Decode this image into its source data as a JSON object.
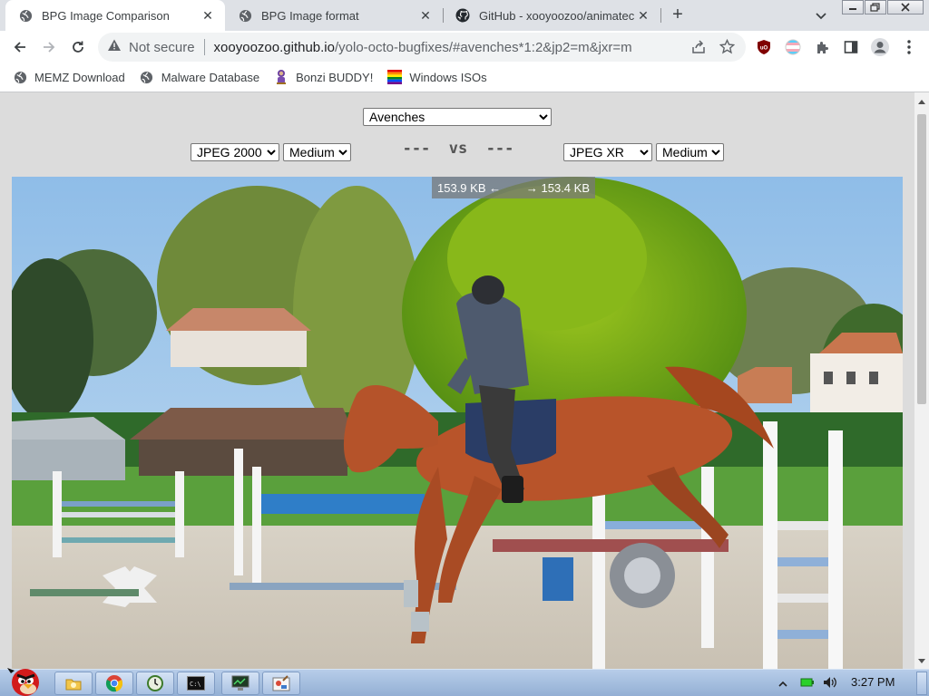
{
  "tabs": [
    {
      "title": "BPG Image Comparison",
      "active": true
    },
    {
      "title": "BPG Image format",
      "active": false
    },
    {
      "title": "GitHub - xooyoozoo/animatec",
      "active": false
    }
  ],
  "toolbar": {
    "security_label": "Not secure",
    "url_host": "xooyoozoo.github.io",
    "url_path": "/yolo-octo-bugfixes/#avenches*1:2&jp2=m&jxr=m"
  },
  "bookmarks": [
    {
      "label": "MEMZ Download",
      "icon": "globe-icon"
    },
    {
      "label": "Malware Database",
      "icon": "globe-icon"
    },
    {
      "label": "Bonzi BUDDY!",
      "icon": "bonzi-icon"
    },
    {
      "label": "Windows ISOs",
      "icon": "windows-flag-icon"
    }
  ],
  "comparison": {
    "image_select": "Avenches",
    "left_format": "JPEG 2000",
    "left_quality": "Medium",
    "vs_label": "---  vs  ---",
    "right_format": "JPEG XR",
    "right_quality": "Medium",
    "left_size": "153.9 KB ←",
    "right_size": "→ 153.4 KB"
  },
  "taskbar": {
    "clock": "3:27 PM"
  },
  "colors": {
    "tabstrip": "#dee1e6",
    "page_bg": "#dcdcdc",
    "taskbar": "#a3bddf"
  }
}
